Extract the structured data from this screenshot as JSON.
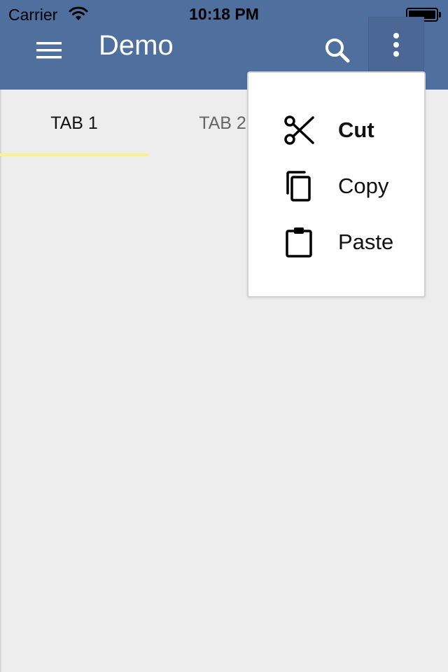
{
  "status_bar": {
    "carrier": "Carrier",
    "time": "10:18 PM"
  },
  "toolbar": {
    "title": "Demo",
    "menu_icon": "hamburger-menu-icon",
    "search_icon": "search-icon",
    "overflow_icon": "more-vert-icon",
    "background": "#4f6f9f"
  },
  "tabs": [
    {
      "label": "TAB 1",
      "selected": true
    },
    {
      "label": "TAB 2",
      "selected": false
    }
  ],
  "tab_indicator_color": "#f8f38a",
  "popup_menu": {
    "items": [
      {
        "label": "Cut",
        "icon": "scissors-icon",
        "bold": true
      },
      {
        "label": "Copy",
        "icon": "copy-icon",
        "bold": false
      },
      {
        "label": "Paste",
        "icon": "clipboard-icon",
        "bold": false
      }
    ]
  }
}
